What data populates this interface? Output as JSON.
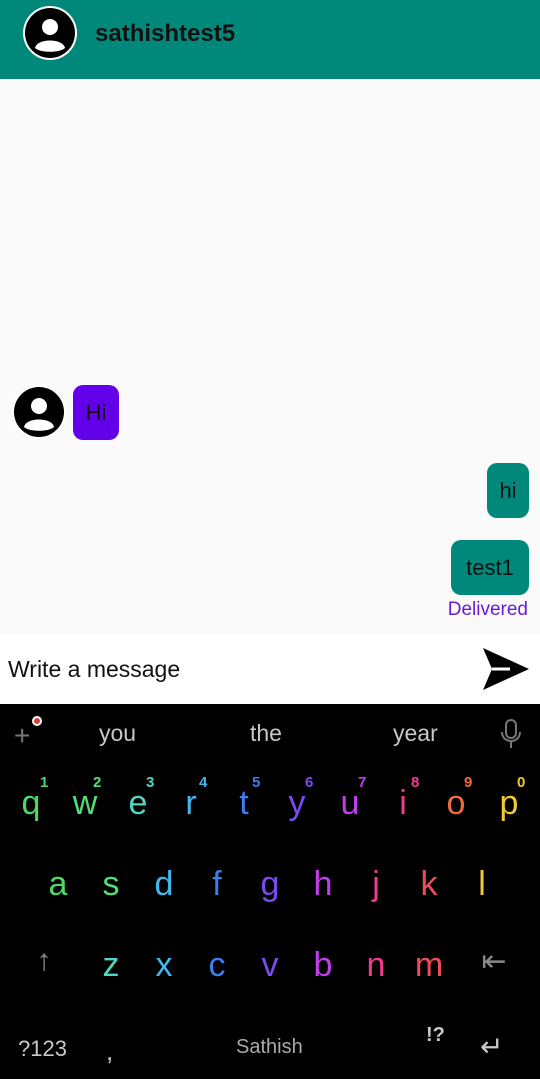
{
  "header": {
    "title": "sathishtest5",
    "avatar_icon": "user-avatar-icon"
  },
  "messages": [
    {
      "direction": "incoming",
      "text": "Hi",
      "color": "#6200ea"
    },
    {
      "direction": "outgoing",
      "text": "hi",
      "color": "#00897b"
    },
    {
      "direction": "outgoing",
      "text": "test1",
      "color": "#00897b"
    }
  ],
  "message_status": "Delivered",
  "composer": {
    "placeholder": "Write a message",
    "send_icon": "send-icon"
  },
  "keyboard": {
    "suggestions": [
      "you",
      "the",
      "year"
    ],
    "row1": [
      {
        "key": "q",
        "hint": "1"
      },
      {
        "key": "w",
        "hint": "2"
      },
      {
        "key": "e",
        "hint": "3"
      },
      {
        "key": "r",
        "hint": "4"
      },
      {
        "key": "t",
        "hint": "5"
      },
      {
        "key": "y",
        "hint": "6"
      },
      {
        "key": "u",
        "hint": "7"
      },
      {
        "key": "i",
        "hint": "8"
      },
      {
        "key": "o",
        "hint": "9"
      },
      {
        "key": "p",
        "hint": "0"
      }
    ],
    "row2": [
      "a",
      "s",
      "d",
      "f",
      "g",
      "h",
      "j",
      "k",
      "l"
    ],
    "row3": [
      "z",
      "x",
      "c",
      "v",
      "b",
      "n",
      "m"
    ],
    "symbols_key": "?123",
    "comma_key": ",",
    "space_label": "Sathish",
    "punct_key": "!?",
    "shift_icon": "shift-icon",
    "backspace_icon": "backspace-icon",
    "enter_icon": "enter-icon"
  },
  "colors": {
    "header": "#00897b",
    "incoming_bubble": "#6200ea",
    "outgoing_bubble": "#00897b",
    "status": "#6a1ad6"
  }
}
